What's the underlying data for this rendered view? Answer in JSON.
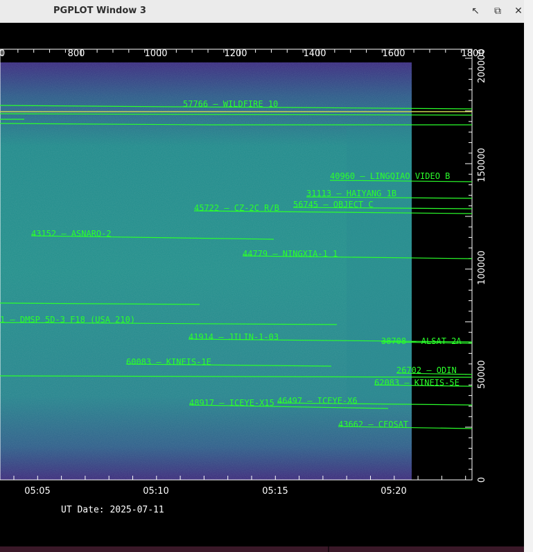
{
  "window": {
    "title": "PGPLOT Window 3",
    "controls": {
      "help": "↖",
      "restore": "⧉",
      "close": "✕"
    }
  },
  "colors": {
    "sat_track": "#2bff2b",
    "yellow_track": "#c8d650",
    "background": "#000000",
    "axis": "#ffffff"
  },
  "plot": {
    "x_top_ticks": [
      "0",
      "800",
      "1000",
      "1200",
      "1400",
      "1600",
      "1800"
    ],
    "y_right_ticks": [
      "200000",
      "150000",
      "100000",
      "50000",
      "0"
    ],
    "x_bottom_ticks": [
      "05:05",
      "05:10",
      "05:15",
      "05:20"
    ],
    "date_label": "UT Date: 2025-07-11",
    "tracks": [
      {
        "label": "57766 – WILDFIRE 10"
      },
      {
        "label": "40960 – LINGQIAO VIDEO B"
      },
      {
        "label": "31113 – HAIYANG 1B"
      },
      {
        "label": "56745 – OBJECT C"
      },
      {
        "label": "45722 – CZ-2C R/B"
      },
      {
        "label": "43152 – ASNARO-2"
      },
      {
        "label": "44779 – NINGXIA-1 1"
      },
      {
        "label": "1 – DMSP 5D-3 F18 (USA 210)"
      },
      {
        "label": "41914 – JILIN-1-03"
      },
      {
        "label": "38708 – ALSAT 2A"
      },
      {
        "label": "60083 – KINEIS-1E"
      },
      {
        "label": "26702 – ODIN"
      },
      {
        "label": "62083 – KINEIS-5E"
      },
      {
        "label": "48917 – ICEYE-X15"
      },
      {
        "label": "46497 – ICEYE-X6"
      },
      {
        "label": "43662 – CFOSAT"
      }
    ]
  }
}
